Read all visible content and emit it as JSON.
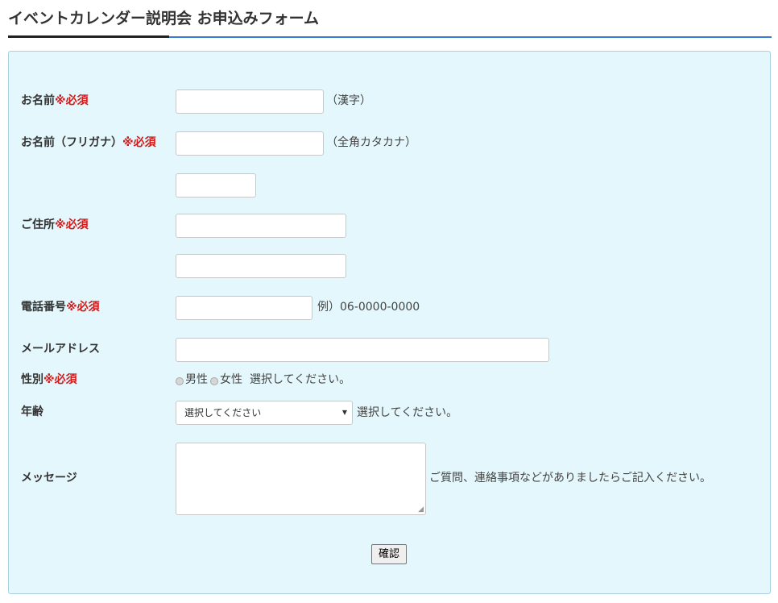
{
  "page": {
    "title": "イベントカレンダー説明会 お申込みフォーム"
  },
  "form": {
    "name": {
      "label": "お名前",
      "required": "※必須",
      "note": "（漢字）",
      "value": ""
    },
    "name_kana": {
      "label": "お名前（フリガナ）",
      "required": "※必須",
      "note": "（全角カタカナ）",
      "value": ""
    },
    "address": {
      "label": "ご住所",
      "required": "※必須",
      "postal_value": "",
      "line1_value": "",
      "line2_value": ""
    },
    "phone": {
      "label": "電話番号",
      "required": "※必須",
      "note": "例）06-0000-0000",
      "value": ""
    },
    "email": {
      "label": "メールアドレス",
      "value": ""
    },
    "gender": {
      "label": "性別",
      "required": "※必須",
      "options": [
        "男性",
        "女性"
      ],
      "note": "選択してください。"
    },
    "age": {
      "label": "年齢",
      "selected": "選択してください",
      "note": "選択してください。"
    },
    "message": {
      "label": "メッセージ",
      "value": "",
      "note": "ご質問、連絡事項などがありましたらご記入ください。"
    },
    "submit_label": "確認"
  },
  "icons": {
    "select_arrow": "dropdown-arrow-icon",
    "resize_grip": "resize-grip-icon"
  },
  "colors": {
    "required": "#d11a1a",
    "panel_bg": "#e4f7fc",
    "title_rule": "#3a7bd5"
  }
}
